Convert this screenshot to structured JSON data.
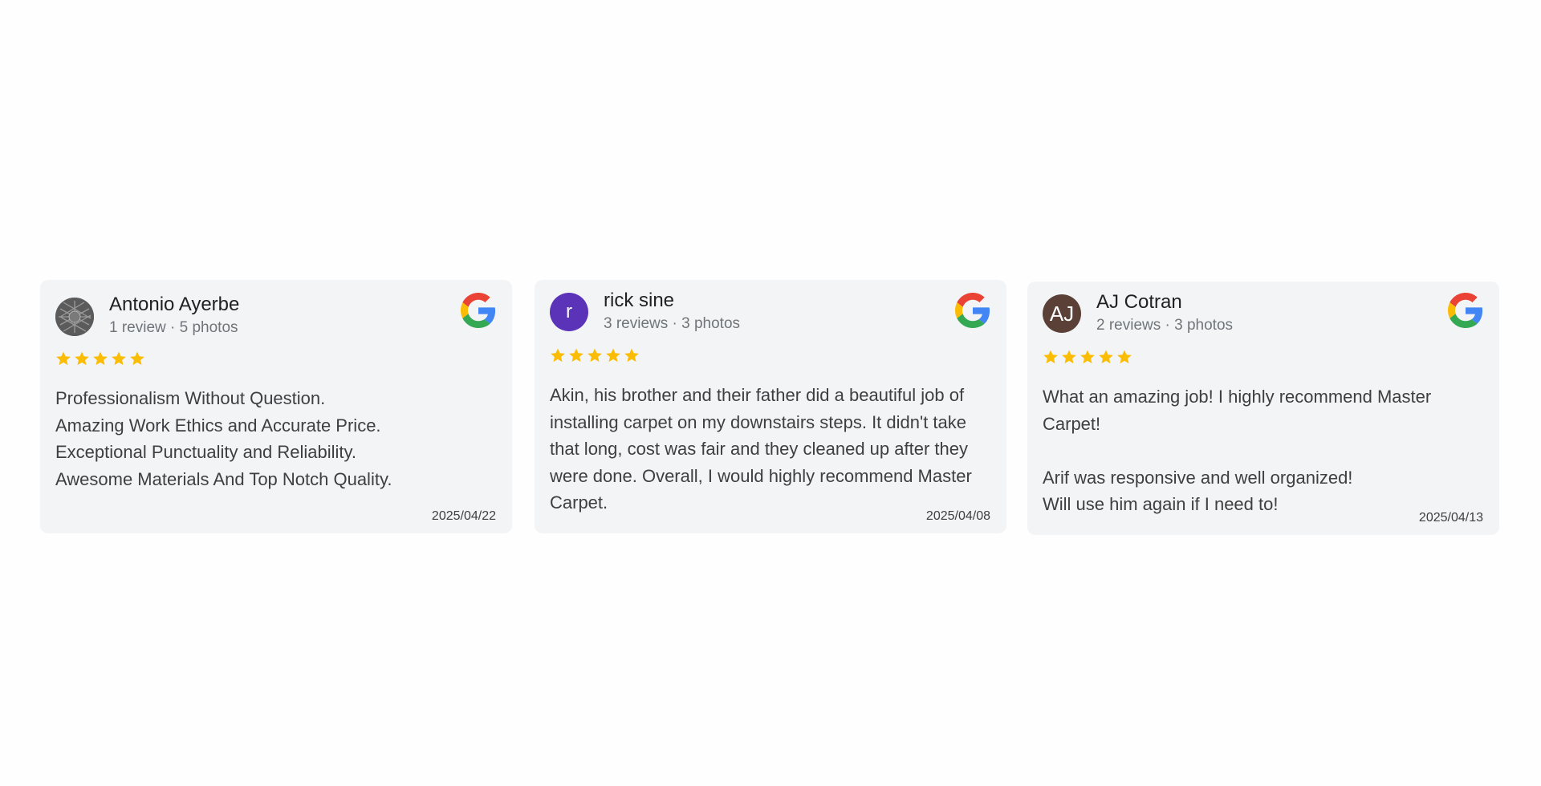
{
  "colors": {
    "card_background": "#f3f4f6",
    "star": "#fbbc04",
    "google_blue": "#4285F4",
    "google_red": "#EA4335",
    "google_yellow": "#FBBC05",
    "google_green": "#34A853"
  },
  "reviews": [
    {
      "avatar_icon": "profile-photo",
      "avatar_initials": "",
      "avatar_color": "#4a4a4a",
      "name": "Antonio Ayerbe",
      "meta": "1 review · 5 photos",
      "source_icon": "google-icon",
      "rating": 5,
      "text": "Professionalism Without Question.\nAmazing Work Ethics and Accurate Price.\nExceptional Punctuality and Reliability.\nAwesome Materials And Top Notch Quality.",
      "date": "2025/04/22"
    },
    {
      "avatar_icon": "initial-avatar",
      "avatar_initials": "r",
      "avatar_color": "#5a33b8",
      "name": "rick sine",
      "meta": "3 reviews · 3 photos",
      "source_icon": "google-icon",
      "rating": 5,
      "text": "Akin, his brother and their father did a beautiful job of installing carpet on my downstairs steps. It didn't take that long, cost was fair and they cleaned up after they were done. Overall, I would highly recommend Master Carpet.",
      "date": "2025/04/08"
    },
    {
      "avatar_icon": "initial-avatar",
      "avatar_initials": "AJ",
      "avatar_color": "#5a4037",
      "name": "AJ Cotran",
      "meta": "2 reviews · 3 photos",
      "source_icon": "google-icon",
      "rating": 5,
      "text": "What an amazing job! I highly recommend Master Carpet!\n\nArif was responsive and well organized!\nWill use him again if I need to!",
      "date": "2025/04/13"
    }
  ]
}
